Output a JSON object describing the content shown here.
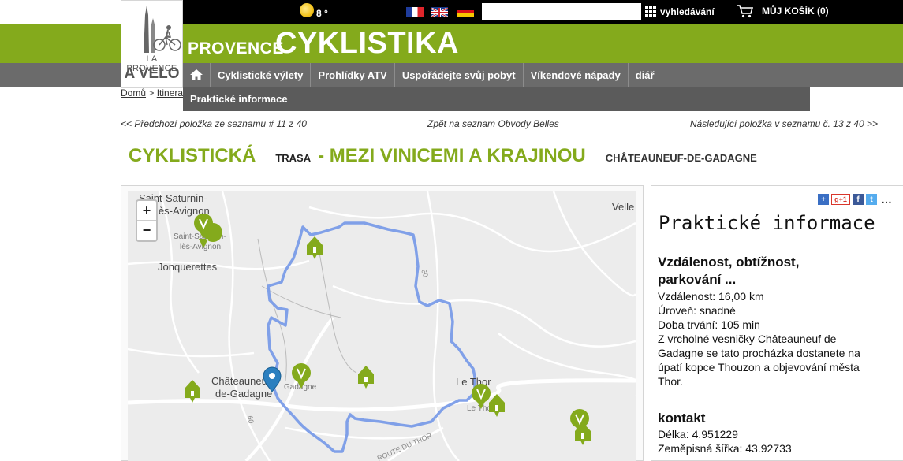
{
  "header": {
    "temperature": "8 °",
    "search_placeholder": "",
    "search_label": "vyhledávání",
    "cart_label": "MŮJ KOŠÍK (0)",
    "brand_small": "PROVENCE",
    "brand_big": "CYKLISTIKA",
    "logo_line1": "LA PROVENCE",
    "logo_line2": "A VELO",
    "languages": [
      "fr",
      "en",
      "de"
    ]
  },
  "nav": {
    "home_icon": "home-icon",
    "items": [
      "Cyklistické výlety",
      "Prohlídky ATV",
      "Uspořádejte svůj pobyt",
      "Víkendové nápady",
      "diář"
    ],
    "subitem": "Praktické informace"
  },
  "breadcrumb": {
    "home": "Domů",
    "sep": ">",
    "current": "Itinera"
  },
  "listnav": {
    "prev": "<< Předchozí položka ze seznamu # 11 z 40",
    "back": "Zpět na seznam Obvody Belles",
    "next": "Následující položka v seznamu č. 13 z 40 >>"
  },
  "title": {
    "main": "CYKLISTICKÁ",
    "trasa": "TRASA",
    "sub": "- MEZI VINICEMI A KRAJINOU",
    "place": "CHÂTEAUNEUF-DE-GADAGNE"
  },
  "map": {
    "zoom_in": "+",
    "zoom_out": "−",
    "labels": {
      "saint_saturnin": "Saint-Saturnin-",
      "les_avignon": "lès-Avignon",
      "saint_saturnin_small1": "Saint-Saturnin-",
      "saint_saturnin_small2": "lès-Avignon",
      "jonquerettes": "Jonquerettes",
      "chateauneuf1": "Châteauneuf-",
      "chateauneuf2": "de-Gadagne",
      "gadagne": "Gadagne",
      "le_thor": "Le Thor",
      "le_thor_small": "Le Thor",
      "velle": "Velle",
      "road_60a": "60",
      "road_60b": "60",
      "road_du_thor": "ROUTE DU THOR"
    },
    "route_color": "#7a9ce8",
    "marker_color": "#84aa1c"
  },
  "panel": {
    "share": {
      "gplus": "g+1",
      "more": "…"
    },
    "title": "Praktické informace",
    "sec1_title": "Vzdálenost, obtížnost, parkování ...",
    "sec1_lines": [
      "Vzdálenost: 16,00 km",
      "Úroveň: snadné",
      "Doba trvání: 105 min",
      "Z vrcholné vesničky Châteauneuf de Gadagne se tato procházka dostanete na úpatí kopce Thouzon a objevování města Thor."
    ],
    "sec2_title": "kontakt",
    "sec2_lines": [
      "Délka: 4.951229",
      "Zeměpisná šířka: 43.92733"
    ]
  }
}
